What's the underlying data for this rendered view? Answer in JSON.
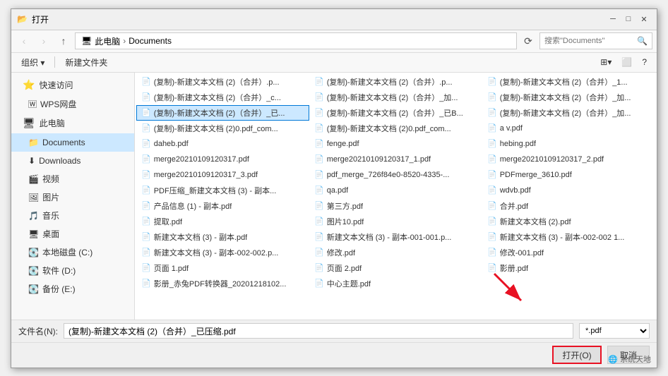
{
  "dialog": {
    "title": "打开",
    "close_btn": "✕",
    "minimize_btn": "─",
    "maximize_btn": "□"
  },
  "address_bar": {
    "back_disabled": true,
    "forward_disabled": true,
    "up_label": "↑",
    "path_parts": [
      "此电脑",
      "Documents"
    ],
    "search_placeholder": "搜索\"Documents\"",
    "refresh_label": "⟳"
  },
  "toolbar": {
    "organize_label": "组织 ▾",
    "new_folder_label": "新建文件夹",
    "view_label": "⊞"
  },
  "sidebar": {
    "quick_access_label": "快速访问",
    "wps_label": "WPS网盘",
    "this_pc_label": "此电脑",
    "documents_label": "Documents",
    "downloads_label": "Downloads",
    "videos_label": "视频",
    "pictures_label": "图片",
    "music_label": "音乐",
    "desktop_label": "桌面",
    "local_disk_c_label": "本地磁盘 (C:)",
    "software_d_label": "软件 (D:)",
    "backup_e_label": "备份 (E:)"
  },
  "files": [
    {
      "name": "(复制)-新建文本文档 (2)（合并）.p...",
      "type": "pdf"
    },
    {
      "name": "(复制)-新建文本文档 (2)（合并）.p...",
      "type": "pdf"
    },
    {
      "name": "(复制)-新建文本文档 (2)（合并）_1...",
      "type": "pdf"
    },
    {
      "name": "(复制)-新建文本文档 (2)（合并）_c...",
      "type": "pdf"
    },
    {
      "name": "(复制)-新建文本文档 (2)（合并）_加...",
      "type": "pdf"
    },
    {
      "name": "(复制)-新建文本文档 (2)（合并）_加...",
      "type": "pdf"
    },
    {
      "name": "(复制)-新建文本文档 (2)（合并）_已...",
      "type": "pdf",
      "selected": true
    },
    {
      "name": "(复制)-新建文本文档 (2)（合并）_已B...",
      "type": "pdf"
    },
    {
      "name": "(复制)-新建文本文档 (2)（合并）_加...",
      "type": "pdf"
    },
    {
      "name": "(复制)-新建文本文档 (2)0.pdf_com...",
      "type": "pdf"
    },
    {
      "name": "(复制)-新建文本文档 (2)0.pdf_com...",
      "type": "pdf"
    },
    {
      "name": "a v.pdf",
      "type": "pdf"
    },
    {
      "name": "daheb.pdf",
      "type": "pdf"
    },
    {
      "name": "fenge.pdf",
      "type": "pdf"
    },
    {
      "name": "hebing.pdf",
      "type": "pdf"
    },
    {
      "name": "merge20210109120317.pdf",
      "type": "pdf"
    },
    {
      "name": "merge20210109120317_1.pdf",
      "type": "pdf"
    },
    {
      "name": "merge20210109120317_2.pdf",
      "type": "pdf"
    },
    {
      "name": "merge20210109120317_3.pdf",
      "type": "pdf"
    },
    {
      "name": "pdf_merge_726f84e0-8520-4335-...",
      "type": "pdf"
    },
    {
      "name": "PDFmerge_3610.pdf",
      "type": "pdf"
    },
    {
      "name": "PDF压缩_新建文本文档 (3) - 副本...",
      "type": "pdf"
    },
    {
      "name": "qa.pdf",
      "type": "pdf"
    },
    {
      "name": "wdvb.pdf",
      "type": "pdf"
    },
    {
      "name": "产品信息 (1) - 副本.pdf",
      "type": "pdf"
    },
    {
      "name": "第三方.pdf",
      "type": "pdf"
    },
    {
      "name": "合并.pdf",
      "type": "pdf"
    },
    {
      "name": "提取.pdf",
      "type": "pdf"
    },
    {
      "name": "图片10.pdf",
      "type": "pdf"
    },
    {
      "name": "新建文本文档 (2).pdf",
      "type": "pdf"
    },
    {
      "name": "新建文本文档 (3) - 副本.pdf",
      "type": "pdf"
    },
    {
      "name": "新建文本文档 (3) - 副本-001-001.p...",
      "type": "pdf"
    },
    {
      "name": "新建文本文档 (3) - 副本-002-002 1...",
      "type": "pdf"
    },
    {
      "name": "新建文本文档 (3) - 副本-002-002.p...",
      "type": "pdf"
    },
    {
      "name": "修改.pdf",
      "type": "pdf"
    },
    {
      "name": "修改-001.pdf",
      "type": "pdf"
    },
    {
      "name": "页面 1.pdf",
      "type": "pdf"
    },
    {
      "name": "页面 2.pdf",
      "type": "pdf"
    },
    {
      "name": "影册.pdf",
      "type": "pdf"
    },
    {
      "name": "影册_赤兔PDF转换器_20201218102...",
      "type": "pdf"
    },
    {
      "name": "中心主题.pdf",
      "type": "pdf"
    }
  ],
  "bottom": {
    "filename_label": "文件名(N):",
    "filename_value": "(复制)-新建文本文档 (2)（合并）_已压缩.pdf",
    "filetype_value": "*.pdf",
    "open_label": "打开(O)",
    "cancel_label": "取消"
  },
  "watermark": {
    "text": "系统天地"
  }
}
